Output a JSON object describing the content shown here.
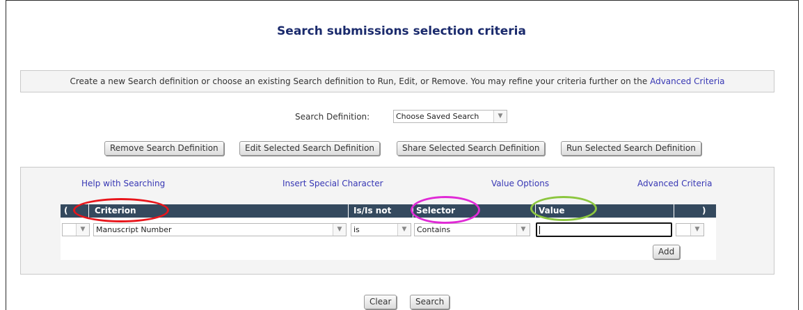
{
  "page": {
    "title": "Search submissions selection criteria",
    "intro_text": "Create a new Search definition or choose an existing Search definition to Run, Edit, or Remove.  You may refine your criteria further on the",
    "intro_link": "Advanced Criteria"
  },
  "search_definition": {
    "label": "Search Definition:",
    "selected": "Choose Saved Search"
  },
  "definition_buttons": {
    "remove": "Remove Search Definition",
    "edit": "Edit Selected Search Definition",
    "share": "Share Selected Search Definition",
    "run": "Run Selected Search Definition"
  },
  "panel_links": {
    "help": "Help with Searching",
    "special": "Insert Special Character",
    "value_options": "Value Options",
    "advanced": "Advanced Criteria"
  },
  "table": {
    "headers": {
      "open_paren": "(",
      "criterion": "Criterion",
      "is_is_not": "Is/Is not",
      "selector": "Selector",
      "value": "Value",
      "close_paren": ")"
    },
    "row": {
      "open_paren": "",
      "criterion": "Manuscript Number",
      "is_is_not": "is",
      "selector": "Contains",
      "value": "",
      "close_paren": ""
    },
    "add_label": "Add"
  },
  "footer_buttons": {
    "clear": "Clear",
    "search": "Search"
  },
  "annotations": {
    "criterion_color": "#e8151b",
    "selector_color": "#e02ad6",
    "value_color": "#8cc63f"
  },
  "icons": {
    "dropdown": "chevron-down-icon"
  }
}
